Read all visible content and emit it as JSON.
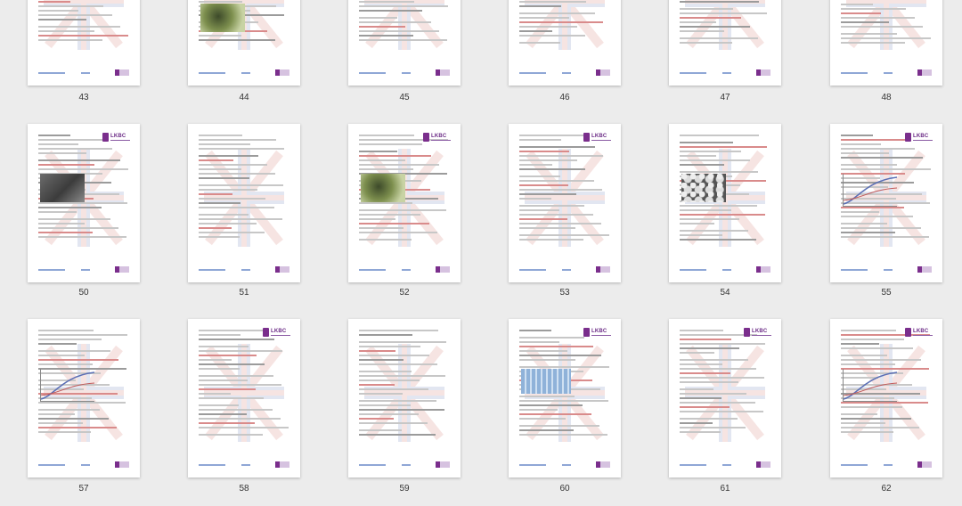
{
  "pages": [
    {
      "number": "43",
      "row": 0,
      "col": 0,
      "figure": "none",
      "logo": false
    },
    {
      "number": "44",
      "row": 0,
      "col": 1,
      "figure": "green",
      "logo": false
    },
    {
      "number": "45",
      "row": 0,
      "col": 2,
      "figure": "none",
      "logo": false
    },
    {
      "number": "46",
      "row": 0,
      "col": 3,
      "figure": "none",
      "logo": false
    },
    {
      "number": "47",
      "row": 0,
      "col": 4,
      "figure": "none",
      "logo": false
    },
    {
      "number": "48",
      "row": 0,
      "col": 5,
      "figure": "none",
      "logo": false
    },
    {
      "number": "50",
      "row": 1,
      "col": 0,
      "figure": "photo",
      "logo": true
    },
    {
      "number": "51",
      "row": 1,
      "col": 1,
      "figure": "none",
      "logo": false
    },
    {
      "number": "52",
      "row": 1,
      "col": 2,
      "figure": "green",
      "logo": true
    },
    {
      "number": "53",
      "row": 1,
      "col": 3,
      "figure": "none",
      "logo": true
    },
    {
      "number": "54",
      "row": 1,
      "col": 4,
      "figure": "cells",
      "logo": false
    },
    {
      "number": "55",
      "row": 1,
      "col": 5,
      "figure": "chart",
      "logo": true
    },
    {
      "number": "57",
      "row": 2,
      "col": 0,
      "figure": "chart",
      "logo": false
    },
    {
      "number": "58",
      "row": 2,
      "col": 1,
      "figure": "none",
      "logo": true
    },
    {
      "number": "59",
      "row": 2,
      "col": 2,
      "figure": "none",
      "logo": false
    },
    {
      "number": "60",
      "row": 2,
      "col": 3,
      "figure": "plate",
      "logo": true
    },
    {
      "number": "61",
      "row": 2,
      "col": 4,
      "figure": "none",
      "logo": true
    },
    {
      "number": "62",
      "row": 2,
      "col": 5,
      "figure": "chart",
      "logo": true
    }
  ],
  "logo_text": "LKBC",
  "colors": {
    "accent": "#6b2b86",
    "footer": "#8fa7d6"
  }
}
